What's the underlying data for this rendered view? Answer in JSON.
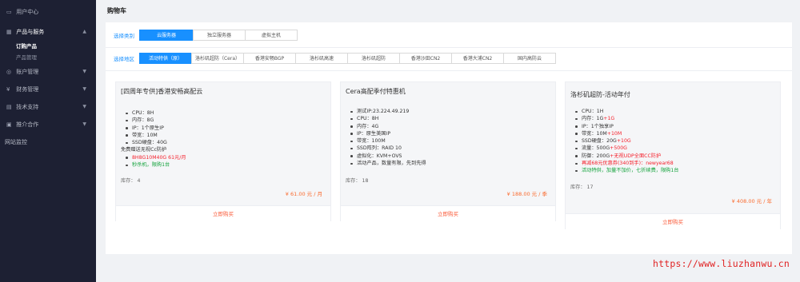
{
  "sidebar": {
    "user_center": "用户中心",
    "products": "产品与服务",
    "sub_order": "订购产品",
    "sub_manage": "产品管理",
    "account": "账户管理",
    "finance": "财务管理",
    "support": "技术支持",
    "affiliate": "推介合作",
    "monitor": "网站监控"
  },
  "page": {
    "title": "购物车"
  },
  "filters": {
    "category_label": "选择类别",
    "categories": [
      "云服务器",
      "独立服务器",
      "虚拟主机"
    ],
    "region_label": "选择地区",
    "regions": [
      "活动特供（原）",
      "洛杉矶超防（Cera）",
      "香港安畅BGP",
      "洛杉矶高速",
      "洛杉矶超防",
      "香港沙田CN2",
      "香港大浦CN2",
      "国内高防云"
    ]
  },
  "products": [
    {
      "title": "[四周年专供]香港安畅高配云",
      "specs": [
        "CPU：8H",
        "内存：8G",
        "IP：1个原生IP",
        "带宽：10M",
        "SSD硬盘：40G"
      ],
      "note": "免费赠送无视Cc防护",
      "promo1": "8H8G10M40G 61元/月",
      "promo2": "秒杀机，限购1台",
      "stock": "库存： 4",
      "price": "¥ 61.00 元 / 月",
      "buy": "立即购买"
    },
    {
      "title": "Cera高配季付特惠机",
      "specs": [
        "测试IP:23.224.49.219",
        "CPU：8H",
        "内存：4G",
        "IP：原生美国IP",
        "带宽：100M",
        "SSD阵列：RAID 10",
        "虚拟化：KVM+OVS",
        "活动产品，数量有限，先到先得"
      ],
      "stock": "库存： 18",
      "price": "¥ 188.00 元 / 季",
      "buy": "立即购买"
    },
    {
      "title": "洛杉矶超防-活动年付",
      "spec1": "CPU：1H",
      "spec2_a": "内存：1G",
      "spec2_b": "+1G",
      "spec3": "IP：1个独享IP",
      "spec4_a": "带宽：10M",
      "spec4_b": "+10M",
      "spec5_a": "SSD硬盘：20G",
      "spec5_b": "+10G",
      "spec6_a": "流量：500G",
      "spec6_b": "+500G",
      "spec7_a": "防御：200G",
      "spec7_b": "+无视UDP全面CC防护",
      "promo1": "再减68元优惠券(340到手)：newyear68",
      "promo2": "活动特供，加量不加价，七折续费，限购1台",
      "stock": "库存： 17",
      "price": "¥ 408.00 元 / 年",
      "buy": "立即购买"
    }
  ],
  "watermark": "https://www.liuzhanwu.cn"
}
